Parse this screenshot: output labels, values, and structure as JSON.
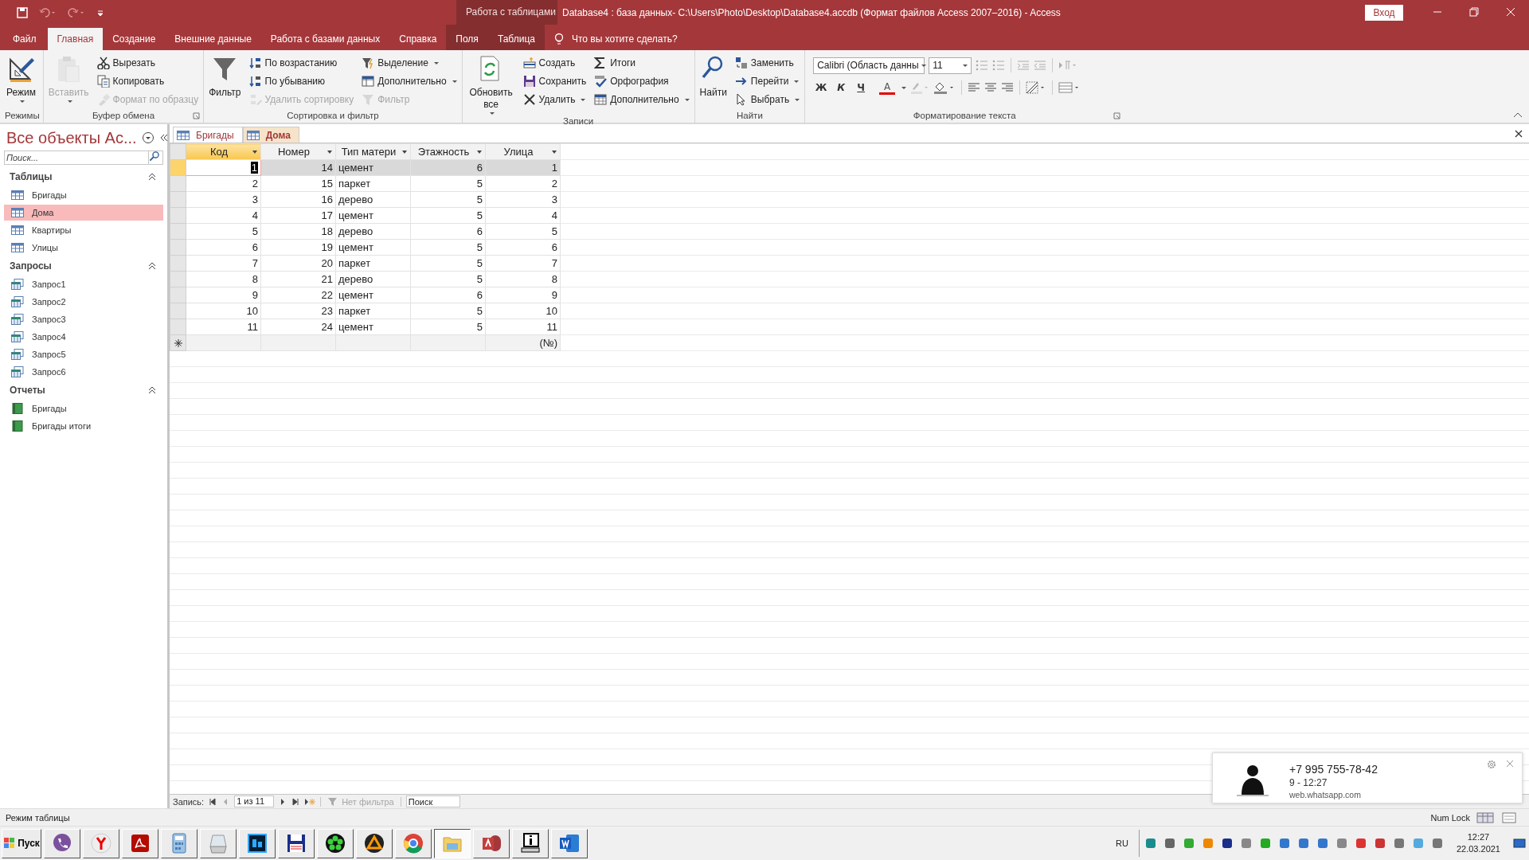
{
  "title_bar": {
    "context_group": "Работа с таблицами",
    "title": "Database4 : база данных- C:\\Users\\Photo\\Desktop\\Database4.accdb (Формат файлов Access 2007–2016)  -  Access",
    "sign_in": "Вход"
  },
  "ribbon_tabs": [
    {
      "label": "Файл",
      "selected": false,
      "kind": "file"
    },
    {
      "label": "Главная",
      "selected": true,
      "kind": "normal"
    },
    {
      "label": "Создание",
      "selected": false,
      "kind": "normal"
    },
    {
      "label": "Внешние данные",
      "selected": false,
      "kind": "normal"
    },
    {
      "label": "Работа с базами данных",
      "selected": false,
      "kind": "normal"
    },
    {
      "label": "Справка",
      "selected": false,
      "kind": "normal"
    },
    {
      "label": "Поля",
      "selected": false,
      "kind": "context"
    },
    {
      "label": "Таблица",
      "selected": false,
      "kind": "context"
    }
  ],
  "tell_me": {
    "placeholder": "Что вы хотите сделать?"
  },
  "ribbon_groups": [
    {
      "label": "Режимы",
      "large": [
        {
          "label": "Режим",
          "dropdown": true,
          "disabled": false
        }
      ]
    },
    {
      "label": "Буфер обмена",
      "launcher": true,
      "large": [
        {
          "label": "Вставить",
          "dropdown": true,
          "disabled": true
        }
      ],
      "columns": [
        [
          {
            "label": "Вырезать",
            "dropdown": false,
            "disabled": false
          },
          {
            "label": "Копировать",
            "dropdown": false,
            "disabled": false
          },
          {
            "label": "Формат по образцу",
            "dropdown": false,
            "disabled": true
          }
        ]
      ]
    },
    {
      "label": "Сортировка и фильтр",
      "large": [
        {
          "label": "Фильтр",
          "dropdown": false,
          "disabled": false
        }
      ],
      "columns": [
        [
          {
            "label": "По возрастанию",
            "dropdown": false,
            "disabled": false
          },
          {
            "label": "По убыванию",
            "dropdown": false,
            "disabled": false
          },
          {
            "label": "Удалить сортировку",
            "dropdown": false,
            "disabled": true
          }
        ],
        [
          {
            "label": "Выделение",
            "dropdown": true,
            "disabled": false
          },
          {
            "label": "Дополнительно",
            "dropdown": true,
            "disabled": false
          },
          {
            "label": "Фильтр",
            "dropdown": false,
            "disabled": true
          }
        ]
      ]
    },
    {
      "label": "Записи",
      "large": [
        {
          "label": "Обновить все",
          "dropdown": true,
          "disabled": false
        }
      ],
      "columns": [
        [
          {
            "label": "Создать",
            "dropdown": false,
            "disabled": false
          },
          {
            "label": "Сохранить",
            "dropdown": false,
            "disabled": false
          },
          {
            "label": "Удалить",
            "dropdown": true,
            "disabled": false
          }
        ],
        [
          {
            "label": "Итоги",
            "dropdown": false,
            "disabled": false
          },
          {
            "label": "Орфография",
            "dropdown": false,
            "disabled": false
          },
          {
            "label": "Дополнительно",
            "dropdown": true,
            "disabled": false
          }
        ]
      ]
    },
    {
      "label": "Найти",
      "large": [
        {
          "label": "Найти",
          "dropdown": false,
          "disabled": false
        }
      ],
      "columns": [
        [
          {
            "label": "Заменить",
            "dropdown": false,
            "disabled": false
          },
          {
            "label": "Перейти",
            "dropdown": true,
            "disabled": false
          },
          {
            "label": "Выбрать",
            "dropdown": true,
            "disabled": false
          }
        ]
      ]
    }
  ],
  "text_format": {
    "label": "Форматирование текста",
    "font": "Calibri (Область данны",
    "size": "11",
    "buttons": [
      {
        "label": "Ж",
        "kind": "bold"
      },
      {
        "label": "К",
        "kind": "italic"
      },
      {
        "label": "Ч",
        "kind": "underline"
      },
      {
        "label": "A",
        "kind": "font-color"
      }
    ]
  },
  "nav_pane": {
    "title": "Все объекты Ac...",
    "search": {
      "placeholder": "Поиск..."
    },
    "groups": [
      {
        "label": "Таблицы",
        "expanded": true,
        "items": [
          {
            "label": "Бригады",
            "kind": "table",
            "selected": false
          },
          {
            "label": "Дома",
            "kind": "table",
            "selected": true
          },
          {
            "label": "Квартиры",
            "kind": "table",
            "selected": false
          },
          {
            "label": "Улицы",
            "kind": "table",
            "selected": false
          }
        ]
      },
      {
        "label": "Запросы",
        "expanded": true,
        "items": [
          {
            "label": "Запрос1",
            "kind": "query",
            "selected": false
          },
          {
            "label": "Запрос2",
            "kind": "query",
            "selected": false
          },
          {
            "label": "Запрос3",
            "kind": "query",
            "selected": false
          },
          {
            "label": "Запрос4",
            "kind": "query",
            "selected": false
          },
          {
            "label": "Запрос5",
            "kind": "query",
            "selected": false
          },
          {
            "label": "Запрос6",
            "kind": "query",
            "selected": false
          }
        ]
      },
      {
        "label": "Отчеты",
        "expanded": true,
        "items": [
          {
            "label": "Бригады",
            "kind": "report",
            "selected": false
          },
          {
            "label": "Бригады итоги",
            "kind": "report",
            "selected": false
          }
        ]
      }
    ]
  },
  "doc_tabs": [
    {
      "label": "Бригады",
      "selected": false
    },
    {
      "label": "Дома",
      "selected": true
    }
  ],
  "datasheet": {
    "columns": [
      {
        "label": "Код",
        "kind": "number",
        "selected": true
      },
      {
        "label": "Номер",
        "kind": "number",
        "selected": false
      },
      {
        "label": "Тип матери",
        "kind": "text",
        "selected": false
      },
      {
        "label": "Этажность",
        "kind": "number",
        "selected": false
      },
      {
        "label": "Улица",
        "kind": "number",
        "selected": false
      }
    ],
    "rows": [
      {
        "selected": true,
        "cells": [
          "1",
          "14",
          "цемент",
          "6",
          "1"
        ]
      },
      {
        "selected": false,
        "cells": [
          "2",
          "15",
          "паркет",
          "5",
          "2"
        ]
      },
      {
        "selected": false,
        "cells": [
          "3",
          "16",
          "дерево",
          "5",
          "3"
        ]
      },
      {
        "selected": false,
        "cells": [
          "4",
          "17",
          "цемент",
          "5",
          "4"
        ]
      },
      {
        "selected": false,
        "cells": [
          "5",
          "18",
          "дерево",
          "6",
          "5"
        ]
      },
      {
        "selected": false,
        "cells": [
          "6",
          "19",
          "цемент",
          "5",
          "6"
        ]
      },
      {
        "selected": false,
        "cells": [
          "7",
          "20",
          "паркет",
          "5",
          "7"
        ]
      },
      {
        "selected": false,
        "cells": [
          "8",
          "21",
          "дерево",
          "5",
          "8"
        ]
      },
      {
        "selected": false,
        "cells": [
          "9",
          "22",
          "цемент",
          "6",
          "9"
        ]
      },
      {
        "selected": false,
        "cells": [
          "10",
          "23",
          "паркет",
          "5",
          "10"
        ]
      },
      {
        "selected": false,
        "cells": [
          "11",
          "24",
          "цемент",
          "5",
          "11"
        ]
      }
    ],
    "new_row": {
      "last_cell": "(№)"
    }
  },
  "record_nav": {
    "label": "Запись:",
    "position": "1 из 11",
    "filter": "Нет фильтра",
    "search": {
      "placeholder": "Поиск"
    }
  },
  "status_bar": {
    "mode": "Режим таблицы",
    "indicator": "Num Lock"
  },
  "notification": {
    "title": "+7 995 755-78-42",
    "message": "9 - 12:27",
    "source": "web.whatsapp.com"
  },
  "taskbar": {
    "start": "Пуск",
    "apps": [
      {
        "active": false
      },
      {
        "active": false
      },
      {
        "active": false
      },
      {
        "active": false
      },
      {
        "active": false
      },
      {
        "active": false
      },
      {
        "active": false
      },
      {
        "active": false
      },
      {
        "active": false
      },
      {
        "active": false
      },
      {
        "active": true
      },
      {
        "active": false
      },
      {
        "active": false
      },
      {
        "active": false
      }
    ],
    "language": "RU",
    "time": "12:27",
    "date": "22.03.2021"
  }
}
